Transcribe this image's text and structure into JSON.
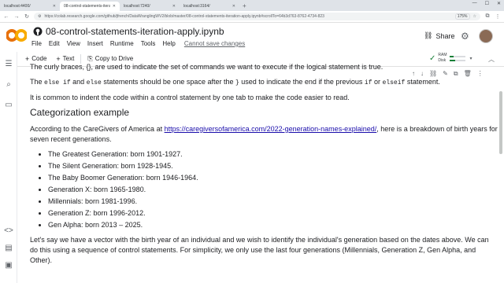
{
  "browser": {
    "tabs": [
      {
        "title": "localhost:4400/",
        "active": false
      },
      {
        "title": "08-control-statements-iterati",
        "active": true
      },
      {
        "title": "localhost:7240/",
        "active": false
      },
      {
        "title": "localhost:3164/",
        "active": false
      }
    ],
    "url": "https://colab.research.google.com/github/jfrench/DataWranglingWV2/blob/master/08-control-statements-iteration-apply.ipynb#scrollTo=64b3d763-8762-4734-823",
    "zoom": "175%"
  },
  "colab": {
    "notebook_title": "08-control-statements-iteration-apply.ipynb",
    "menu": [
      "File",
      "Edit",
      "View",
      "Insert",
      "Runtime",
      "Tools",
      "Help"
    ],
    "unsaved": "Cannot save changes",
    "share_label": "Share"
  },
  "toolbar": {
    "code_label": "Code",
    "text_label": "Text",
    "copy_label": "Copy to Drive",
    "ram_label": "RAM",
    "disk_label": "Disk",
    "ram_level": 0.25,
    "disk_level": 0.35
  },
  "content": {
    "cut_line": "The curly braces, {}, are used to indicate the set of commands we want to execute if the logical statement is true.",
    "p1_a": "The ",
    "p1_code1": "else if",
    "p1_b": " and ",
    "p1_code2": "else",
    "p1_c": " statements should be one space after the ",
    "p1_code3": "}",
    "p1_d": " used to indicate the end if the previous ",
    "p1_code4": "if",
    "p1_e": " or ",
    "p1_code5": "elseif",
    "p1_f": " statement.",
    "p2": "It is common to indent the code within a control statement by one tab to make the code easier to read.",
    "heading": "Categorization example",
    "p3_a": "According to the CareGivers of America at ",
    "p3_link": "https://caregiversofamerica.com/2022-generation-names-explained/",
    "p3_b": ", here is a breakdown of birth years for seven recent generations.",
    "generations": [
      "The Greatest Generation: born 1901-1927.",
      "The Silent Generation: born 1928-1945.",
      "The Baby Boomer Generation: born 1946-1964.",
      "Generation X: born 1965-1980.",
      "Millennials: born 1981-1996.",
      "Generation Z: born 1996-2012.",
      "Gen Alpha: born 2013 – 2025."
    ],
    "p4": "Let's say we have a vector with the birth year of an individual and we wish to identify the individual's generation based on the dates above. We can do this using a sequence of control statements. For simplicity, we only use the last four generations (Millennials, Generation Z, Gen Alpha, and Other)."
  }
}
